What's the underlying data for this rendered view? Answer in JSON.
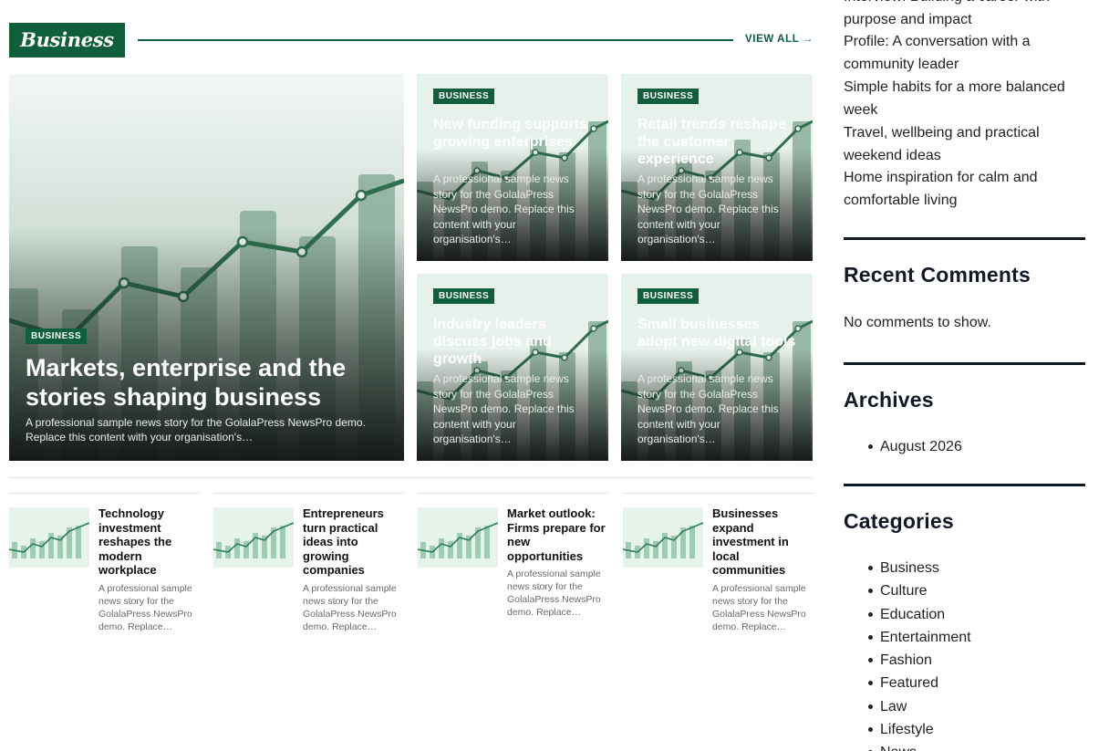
{
  "section": {
    "title": "Business",
    "view_all": "VIEW ALL →"
  },
  "hero": {
    "category": "BUSINESS",
    "title": "Markets, enterprise and the stories shaping business",
    "excerpt": "A professional sample news story for the GolalaPress NewsPro demo. Replace this content with your organisation's…"
  },
  "grid_cards": [
    {
      "category": "BUSINESS",
      "title": "New funding supports growing enterprises",
      "excerpt": "A professional sample news story for the GolalaPress NewsPro demo. Replace this content with your organisation's…"
    },
    {
      "category": "BUSINESS",
      "title": "Retail trends reshape the customer experience",
      "excerpt": "A professional sample news story for the GolalaPress NewsPro demo. Replace this content with your organisation's…"
    },
    {
      "category": "BUSINESS",
      "title": "Industry leaders discuss jobs and growth",
      "excerpt": "A professional sample news story for the GolalaPress NewsPro demo. Replace this content with your organisation's…"
    },
    {
      "category": "BUSINESS",
      "title": "Small businesses adopt new digital tools",
      "excerpt": "A professional sample news story for the GolalaPress NewsPro demo. Replace this content with your organisation's…"
    }
  ],
  "list_items": [
    {
      "title": "Technology investment reshapes the modern workplace",
      "excerpt": "A professional sample news story for the GolalaPress NewsPro demo. Replace…"
    },
    {
      "title": "Entrepreneurs turn practical ideas into growing companies",
      "excerpt": "A professional sample news story for the GolalaPress NewsPro demo. Replace…"
    },
    {
      "title": "Market outlook: Firms prepare for new opportunities",
      "excerpt": "A professional sample news story for the GolalaPress NewsPro demo. Replace…"
    },
    {
      "title": "Businesses expand investment in local communities",
      "excerpt": "A professional sample news story for the GolalaPress NewsPro demo. Replace…"
    }
  ],
  "sidebar": {
    "recent_posts": [
      "Interview: Building a career with purpose and impact",
      "Profile: A conversation with a community leader",
      "Simple habits for a more balanced week",
      "Travel, wellbeing and practical weekend ideas",
      "Home inspiration for calm and comfortable living"
    ],
    "recent_comments": {
      "heading": "Recent Comments",
      "empty_text": "No comments to show."
    },
    "archives": {
      "heading": "Archives",
      "items": [
        "August 2026"
      ]
    },
    "categories": {
      "heading": "Categories",
      "items": [
        "Business",
        "Culture",
        "Education",
        "Entertainment",
        "Fashion",
        "Featured",
        "Law",
        "Lifestyle",
        "News"
      ]
    }
  },
  "colors": {
    "accent": "#0f5f3c",
    "chart_bar": "#8fc7a8",
    "chart_line": "#2e7d55",
    "sidebar_rule": "#111827"
  },
  "icons": {
    "view_all_arrow": "arrow-right-icon",
    "card_art": "growth-chart-icon"
  }
}
